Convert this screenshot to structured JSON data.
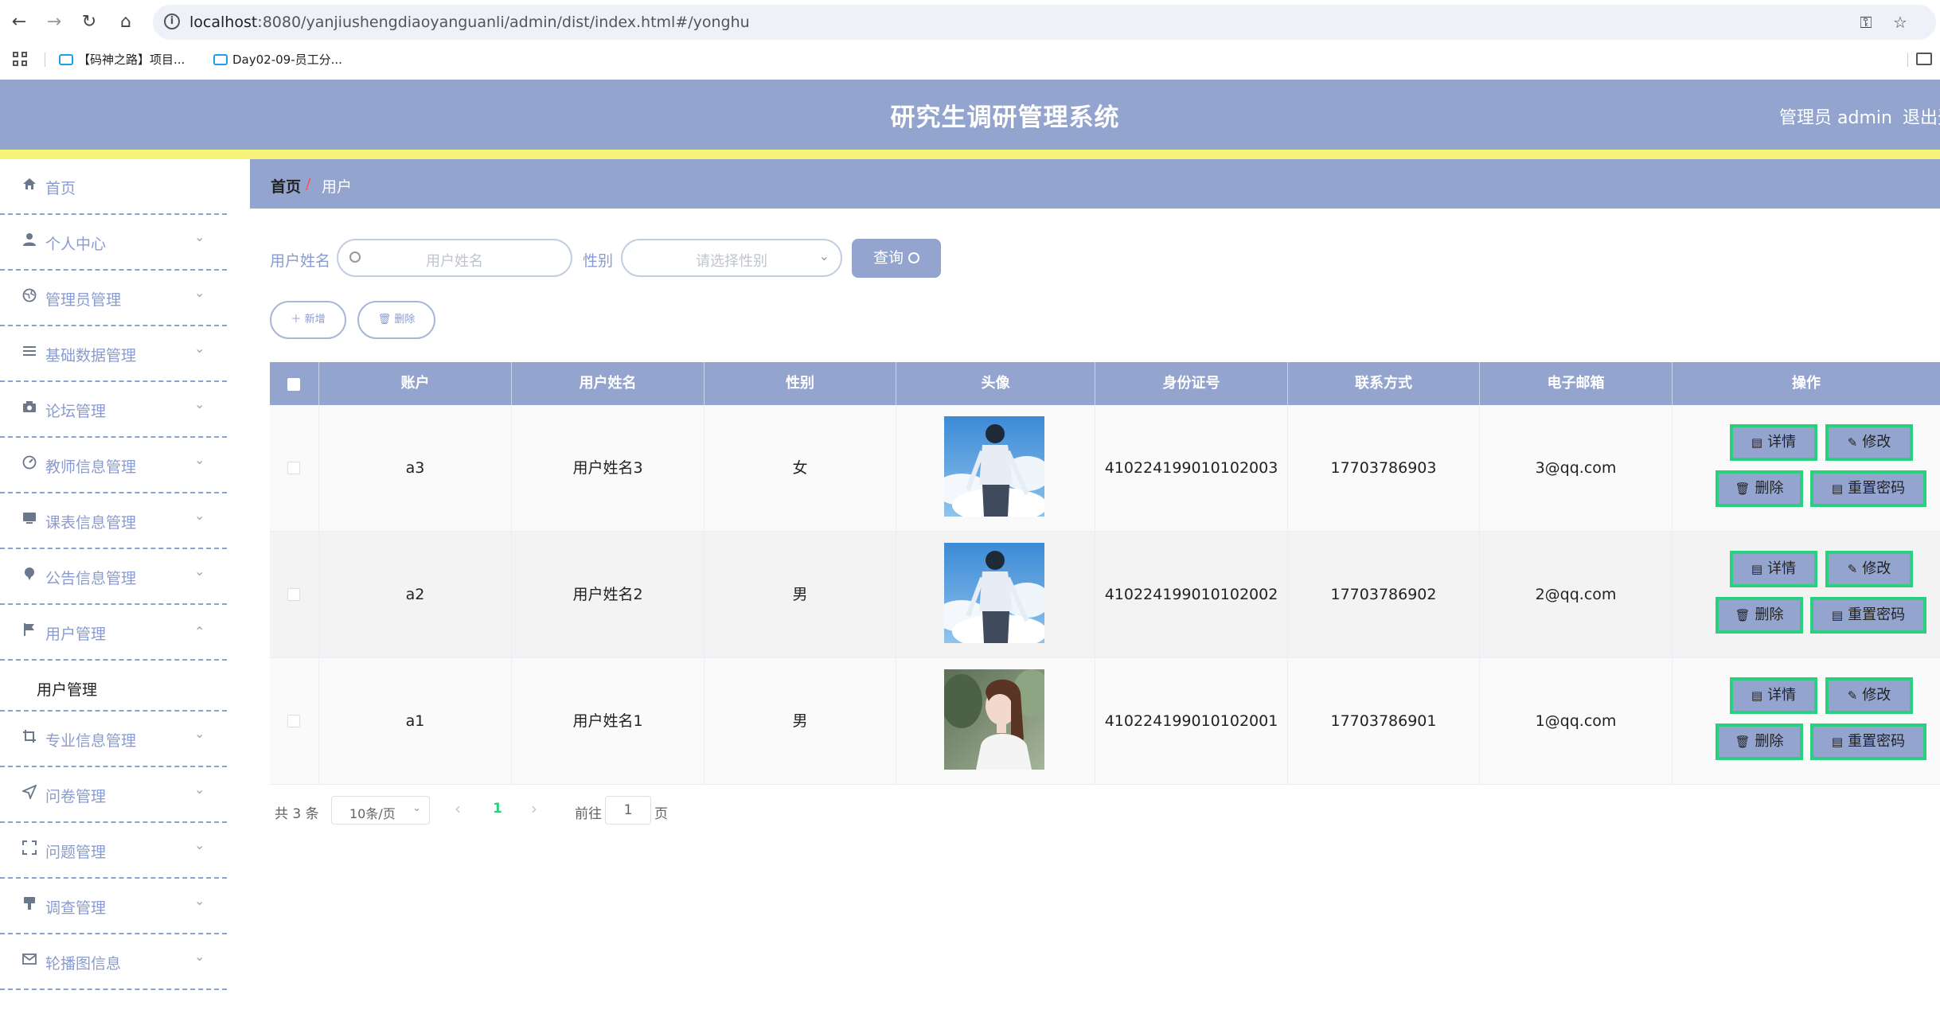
{
  "browser": {
    "url_host": "localhost",
    "url_rest": ":8080/yanjiushengdiaoyanguanli/admin/dist/index.html#/yonghu",
    "bookmarks": [
      "【码神之路】项目...",
      "Day02-09-员工分..."
    ]
  },
  "header": {
    "title": "研究生调研管理系统",
    "admin": "管理员 admin",
    "logout": "退出登录"
  },
  "sidebar": {
    "items": [
      {
        "label": "首页",
        "icon": "home-icon"
      },
      {
        "label": "个人中心",
        "icon": "user-icon"
      },
      {
        "label": "管理员管理",
        "icon": "globe-icon"
      },
      {
        "label": "基础数据管理",
        "icon": "list-icon"
      },
      {
        "label": "论坛管理",
        "icon": "camera-icon"
      },
      {
        "label": "教师信息管理",
        "icon": "gauge-icon"
      },
      {
        "label": "课表信息管理",
        "icon": "monitor-icon"
      },
      {
        "label": "公告信息管理",
        "icon": "pin-icon"
      },
      {
        "label": "用户管理",
        "icon": "flag-icon"
      },
      {
        "label": "专业信息管理",
        "icon": "crop-icon"
      },
      {
        "label": "问卷管理",
        "icon": "send-icon"
      },
      {
        "label": "问题管理",
        "icon": "fullscreen-icon"
      },
      {
        "label": "调查管理",
        "icon": "brush-icon"
      },
      {
        "label": "轮播图信息",
        "icon": "mail-icon"
      }
    ],
    "sub_item": "用户管理"
  },
  "breadcrumb": {
    "home": "首页",
    "separator": "/",
    "current": "用户"
  },
  "search": {
    "name_label": "用户姓名",
    "name_placeholder": "用户姓名",
    "gender_label": "性别",
    "gender_placeholder": "请选择性别",
    "query_button": "查询"
  },
  "actions": {
    "add": "新增",
    "delete": "删除"
  },
  "table": {
    "columns": [
      "账户",
      "用户姓名",
      "性别",
      "头像",
      "身份证号",
      "联系方式",
      "电子邮箱",
      "操作"
    ],
    "rows": [
      {
        "account": "a3",
        "name": "用户姓名3",
        "gender": "女",
        "avatar": "boy-sky",
        "id_no": "410224199010102003",
        "phone": "17703786903",
        "email": "3@qq.com"
      },
      {
        "account": "a2",
        "name": "用户姓名2",
        "gender": "男",
        "avatar": "boy-sky",
        "id_no": "410224199010102002",
        "phone": "17703786902",
        "email": "2@qq.com"
      },
      {
        "account": "a1",
        "name": "用户姓名1",
        "gender": "男",
        "avatar": "girl-forest",
        "id_no": "410224199010102001",
        "phone": "17703786901",
        "email": "1@qq.com"
      }
    ],
    "op_labels": {
      "detail": "详情",
      "edit": "修改",
      "delete": "删除",
      "reset": "重置密码"
    }
  },
  "pagination": {
    "total": "共 3 条",
    "page_size": "10条/页",
    "current_page": "1",
    "goto_label": "前往",
    "goto_value": "1",
    "page_unit": "页"
  },
  "colors": {
    "header_bg": "#93a4cf",
    "accent_yellow": "#f7f47a",
    "op_border": "#2bd07f"
  }
}
